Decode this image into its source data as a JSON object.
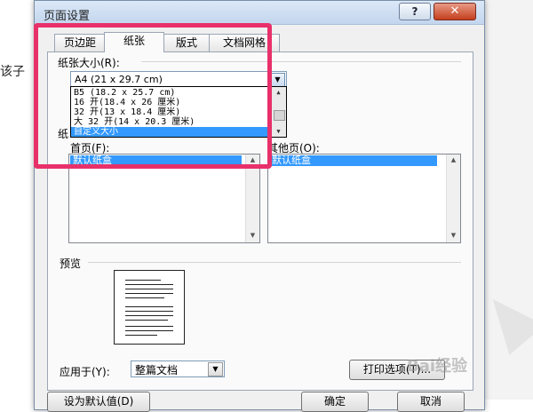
{
  "background": {
    "edge_text": "该子"
  },
  "dialog": {
    "title": "页面设置",
    "help_label": "?",
    "close_label": "✕"
  },
  "tabs": [
    {
      "label": "页边距"
    },
    {
      "label": "纸张"
    },
    {
      "label": "版式"
    },
    {
      "label": "文档网格"
    }
  ],
  "paper_size": {
    "label": "纸张大小(R):",
    "value": "A4 (21 x 29.7 cm)",
    "options": [
      "B5 (18.2 x 25.7 cm)",
      "16 开(18.4 x 26 厘米)",
      "32 开(13 x 18.4 厘米)",
      "大 32 开(14 x 20.3 厘米)",
      "自定义大小"
    ],
    "selected_option": "自定义大小"
  },
  "paper_source": {
    "section_label": "纸",
    "first_page_label": "首页(F):",
    "first_page_items": [
      "默认纸盒"
    ],
    "other_pages_label": "其他页(O):",
    "other_pages_items": [
      "默认纸盒"
    ]
  },
  "preview": {
    "section_label": "预览"
  },
  "apply_to": {
    "label": "应用于(Y):",
    "value": "整篇文档"
  },
  "buttons": {
    "print_options": "打印选项(T)...",
    "set_default": "设为默认值(D)",
    "ok": "确定",
    "cancel": "取消"
  },
  "watermark": "Bai经验",
  "colors": {
    "highlight": "#e8306a",
    "selection": "#3399ff",
    "close_button": "#c43f1d"
  }
}
